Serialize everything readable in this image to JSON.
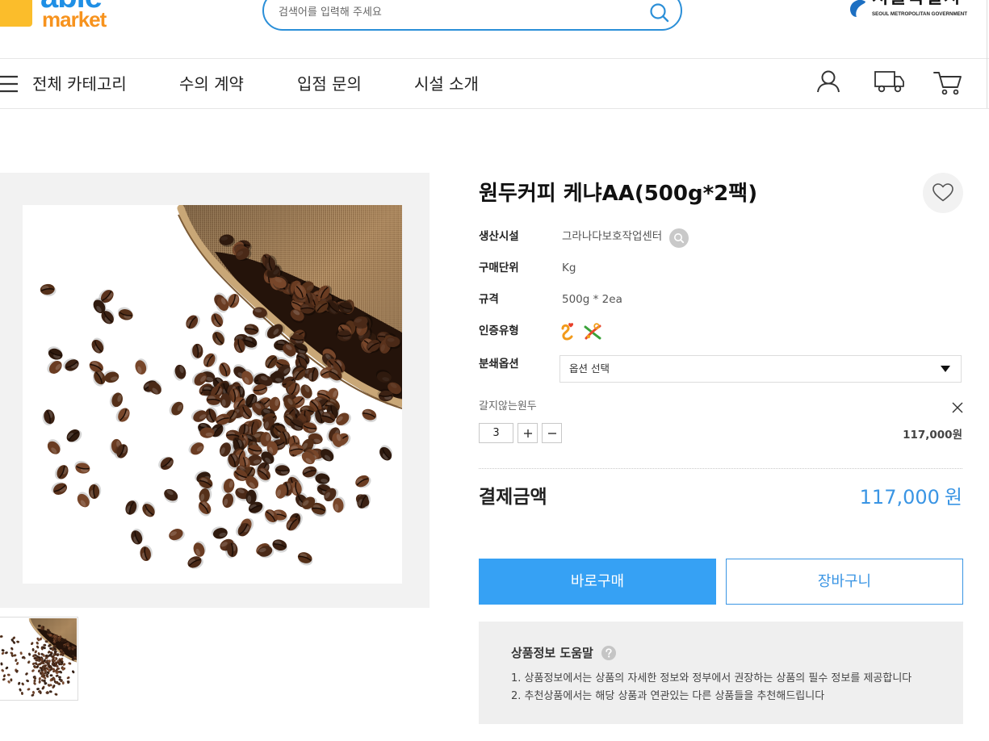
{
  "header": {
    "logo": {
      "line1": "able",
      "line2": "market"
    },
    "search": {
      "placeholder": "검색어를 입력해 주세요",
      "icon": "search-icon"
    },
    "gov_logo": {
      "name_ko": "서울특별시",
      "name_en": "SEOUL METROPOLITAN GOVERNMENT",
      "icon": "seoul-symbol-icon"
    }
  },
  "nav": {
    "menu_icon": "hamburger-menu-icon",
    "all_categories": "전체 카테고리",
    "items": [
      {
        "label": "수의 계약"
      },
      {
        "label": "입점 문의"
      },
      {
        "label": "시설 소개"
      }
    ],
    "utility_icons": [
      "user-icon",
      "truck-icon",
      "cart-icon"
    ]
  },
  "product": {
    "title": "원두커피 케냐AA(500g*2팩)",
    "wishlist_icon": "heart-icon",
    "info": {
      "facility": {
        "label": "생산시설",
        "value": "그라나다보호작업센터",
        "icon": "search-icon"
      },
      "unit": {
        "label": "구매단위",
        "value": "Kg"
      },
      "spec": {
        "label": "규격",
        "value": "500g * 2ea"
      },
      "certification": {
        "label": "인증유형",
        "icons": [
          "certification-mark-icon",
          "certification-mark-icon"
        ]
      }
    },
    "grind_option": {
      "label": "분쇄옵션",
      "selected": "옵션 선택",
      "icon": "dropdown-arrow-icon"
    },
    "selected_item": {
      "name": "갈지않는원두",
      "quantity": "3",
      "price": "117,000원",
      "remove_icon": "close-icon"
    },
    "total": {
      "label": "결제금액",
      "amount": "117,000",
      "unit": "원"
    },
    "actions": {
      "buy_now": "바로구매",
      "add_to_cart": "장바구니"
    },
    "help": {
      "title": "상품정보 도움말",
      "icon": "question-icon",
      "lines": [
        "1. 상품정보에서는 상품의 자세한 정보와 정부에서 권장하는 상품의 필수 정보를 제공합니다",
        "2. 추천상품에서는 해당 상품과 연관있는 다른 상품들을 추천해드립니다"
      ]
    }
  },
  "colors": {
    "accent": "#3a95e4",
    "buy_button": "#36a1f4",
    "logo_yellow": "#fbbd2b",
    "logo_orange": "#f7931e",
    "logo_blue": "#1f8fe5"
  }
}
